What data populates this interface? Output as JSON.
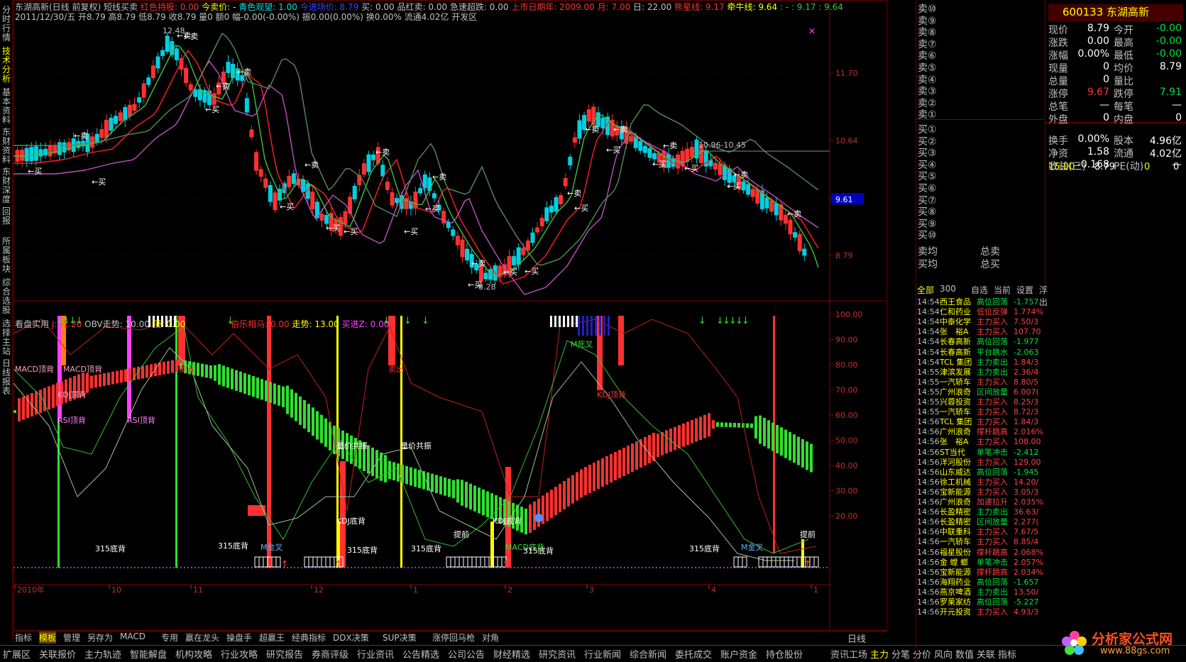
{
  "left_tabs": [
    "分时行情",
    "技术分析",
    "基本资料",
    "东财资料",
    "东财深度",
    "回报",
    "所属板块",
    "综合选股",
    "选择主站",
    "日线报表"
  ],
  "header1": {
    "stock": "东湖高新(日线 前复权)",
    "indicator": "短线买卖",
    "i1": "红色持股: 0.00",
    "i2": "今卖价: -",
    "i3": "青色观望: 1.00",
    "i4": "今进场价: 8.79",
    "i5": "买: 0.00",
    "i6": "品红卖: 0.00",
    "i7": "急速超跌: 0.00",
    "i8": "上市日期年: 2009.00",
    "i9": "月: 7.00",
    "i10": "日: 22.00",
    "i11": "熊星线: 9.17",
    "i12": "牵牛线: 9.64",
    "i13": ": -",
    "i14": ": 9.17",
    "i15": ": 9.64"
  },
  "header2": "2011/12/30/五 开8.79 高8.79 低8.79 收8.79 量0 额0 幅-0.00(-0.00%) 振0.00(0.00%) 换0.00% 流通4.02亿 开发区",
  "sub_header": {
    "a": "看盘实用",
    "b": "J: -1.20",
    "c": "OBV走势: 10.00",
    "d": "顶: 0.00",
    "e": "伯乐相马: 0.00",
    "f": "走势: 13.00",
    "g": "买进Z: 0.00"
  },
  "price_axis": [
    "11.70",
    "10.64",
    "9.61",
    "8.79"
  ],
  "pct_axis": [
    "100.00",
    "90.00",
    "80.00",
    "70.00",
    "60.00",
    "50.00",
    "40.00",
    "30.00",
    "20.00"
  ],
  "date_axis": [
    "2010年",
    "10",
    "11",
    "12",
    "1",
    "2",
    "3",
    "4",
    "1"
  ],
  "daily_label": "日线",
  "annotations": {
    "hi": "12.48",
    "lo": "8.28",
    "lvl": "10.96-10.45",
    "sell": "卖",
    "buy": "买",
    "buy_arrow": "←买",
    "sell_arrow": "←卖"
  },
  "lower_labels": [
    "MACD顶背",
    "MACD顶背",
    "KDJ顶背",
    "RSI顶背",
    "RSI顶背",
    "卖出",
    "卖出",
    "M死叉",
    "KDJ顶背",
    "量价共振",
    "量价共振",
    "KDJ底背",
    "KDJ底背",
    "MACD底背",
    "315底背",
    "315底背",
    "315底背",
    "315底背",
    "315底背",
    "315底背",
    "M金叉",
    "M金叉",
    "提前",
    "提前"
  ],
  "order_book": {
    "sell": [
      "卖⑩",
      "卖⑨",
      "卖⑧",
      "卖⑦",
      "卖⑥",
      "卖⑤",
      "卖④",
      "卖③",
      "卖②",
      "卖①"
    ],
    "buy": [
      "买①",
      "买②",
      "买③",
      "买④",
      "买⑤",
      "买⑥",
      "买⑦",
      "买⑧",
      "买⑨",
      "买⑩"
    ],
    "sell_avg": "卖均",
    "buy_avg": "买均",
    "total_sell": "总卖",
    "total_buy": "总买"
  },
  "quote": {
    "code": "600133 东湖高新",
    "rows": [
      {
        "l1": "现价",
        "v1": "8.79",
        "l2": "今开",
        "v2": "-0.00"
      },
      {
        "l1": "涨跌",
        "v1": "0.00",
        "l2": "最高",
        "v2": "-0.00"
      },
      {
        "l1": "涨幅",
        "v1": "0.00%",
        "l2": "最低",
        "v2": "-0.00"
      },
      {
        "l1": "现量",
        "v1": "0",
        "l2": "均价",
        "v2": "8.79"
      },
      {
        "l1": "总量",
        "v1": "0",
        "l2": "量比",
        "v2": ""
      },
      {
        "l1": "涨停",
        "v1": "9.67",
        "l2": "跌停",
        "v2": "7.91"
      },
      {
        "l1": "总笔",
        "v1": "—",
        "l2": "每笔",
        "v2": "—"
      },
      {
        "l1": "外盘",
        "v1": "0",
        "l2": "内盘",
        "v2": "0"
      },
      {
        "l1": "换手",
        "v1": "0.00%",
        "l2": "股本",
        "v2": "4.96亿"
      },
      {
        "l1": "净资",
        "v1": "1.58",
        "l2": "流通",
        "v2": "4.02亿"
      },
      {
        "l1": "收益(三)",
        "v1": "-0.168",
        "l2": "PE(动)",
        "v2": "—"
      }
    ],
    "time": "15:00",
    "tprice": "8.79",
    "tvol": "0",
    "tz": "0"
  },
  "tick_tabs": [
    "全部",
    "300",
    "自选",
    "当前",
    "设置",
    "浮出"
  ],
  "ticks": [
    [
      "14:54",
      "西王食品",
      "高位回落",
      "-1.757"
    ],
    [
      "14:54",
      "仁和药业",
      "低位反弹",
      "1.774%"
    ],
    [
      "14:54",
      "中泰化学",
      "主力买入",
      "7.50/3"
    ],
    [
      "14:54",
      "张　裕A",
      "主力买入",
      "107.70"
    ],
    [
      "14:54",
      "长春高新",
      "高位回落",
      "-1.977"
    ],
    [
      "14:54",
      "长春高新",
      "平台跳水",
      "-2.063"
    ],
    [
      "14:54",
      "TCL 集团",
      "主力卖出",
      "1.84/3"
    ],
    [
      "14:55",
      "津滨发展",
      "主力卖出",
      "2.36/4"
    ],
    [
      "14:55",
      "一汽轿车",
      "主力买入",
      "8.80/5"
    ],
    [
      "14:55",
      "广州浪奇",
      "区间放量",
      "6.007("
    ],
    [
      "14:55",
      "兴蓉投资",
      "主力买入",
      "8.25/3"
    ],
    [
      "14:55",
      "一汽轿车",
      "主力买入",
      "8.72/3"
    ],
    [
      "14:56",
      "TCL 集团",
      "主力买入",
      "1.84/3"
    ],
    [
      "14:56",
      "广州浪奇",
      "撑杆跳高",
      "2.016%"
    ],
    [
      "14:56",
      "张　裕A",
      "主力买入",
      "108.00"
    ],
    [
      "14:56",
      "ST当代",
      "单笔冲击",
      "-2.412"
    ],
    [
      "14:56",
      "洋河股份",
      "主力买入",
      "129.00"
    ],
    [
      "14:56",
      "山东威达",
      "高位回落",
      "-1.945"
    ],
    [
      "14:56",
      "徐工机械",
      "主力买入",
      "14.20/"
    ],
    [
      "14:56",
      "宝新能源",
      "主力买入",
      "3.05/3"
    ],
    [
      "14:56",
      "广州浪奇",
      "加速拉升",
      "2.035%"
    ],
    [
      "14:56",
      "长盈精密",
      "主力卖出",
      "36.63/"
    ],
    [
      "14:56",
      "长盈精密",
      "区间放量",
      "2.277("
    ],
    [
      "14:56",
      "中联重科",
      "主力买入",
      "7.67/5"
    ],
    [
      "14:56",
      "一汽轿车",
      "主力买入",
      "8.85/4"
    ],
    [
      "14:56",
      "福星股份",
      "撑杆跳高",
      "2.068%"
    ],
    [
      "14:56",
      "金 螳 螂",
      "单笔冲击",
      "2.057%"
    ],
    [
      "14:56",
      "宝新能源",
      "撑杆跳高",
      "2.034%"
    ],
    [
      "14:56",
      "海翔药业",
      "高位回落",
      "-1.657"
    ],
    [
      "14:56",
      "燕京啤酒",
      "主力卖出",
      "13.50/"
    ],
    [
      "14:56",
      "罗莱家纺",
      "高位回落",
      "-5.227"
    ],
    [
      "14:56",
      "开元投资",
      "主力买入",
      "4.93/3"
    ]
  ],
  "bottom_tabs1": [
    "指标",
    "模板",
    "管理",
    "另存为",
    "MACD",
    "专用",
    "赢在龙头",
    "操盘手",
    "超赢王",
    "经典指标",
    "DDX决策",
    "SUP决策",
    "涨停回马枪",
    "对角"
  ],
  "bottom_tabs2": [
    "扩展区",
    "关联报价",
    "主力轨迹",
    "智能解盘",
    "机构攻略",
    "行业攻略",
    "研究报告",
    "券商评级",
    "行业资讯",
    "公告精选",
    "公司公告",
    "财经精选",
    "研究资讯",
    "行业新闻",
    "综合新闻",
    "委托成交",
    "账户资金",
    "持仓股份"
  ],
  "right_tabs2": [
    "资讯工场",
    "主力",
    "分笔",
    "分价",
    "风向",
    "数值",
    "关联",
    "指标"
  ],
  "watermark": {
    "title": "分析家公式网",
    "url": "www.88gs.com"
  },
  "colors": {
    "up": "#ff3030",
    "down": "#00d0e0",
    "ma1": "#ff2020",
    "ma2": "#c050c0",
    "ma3": "#40c040",
    "ma4": "#60a060",
    "green": "#30e030",
    "yellow": "#ffff00",
    "magenta": "#ff40ff"
  }
}
